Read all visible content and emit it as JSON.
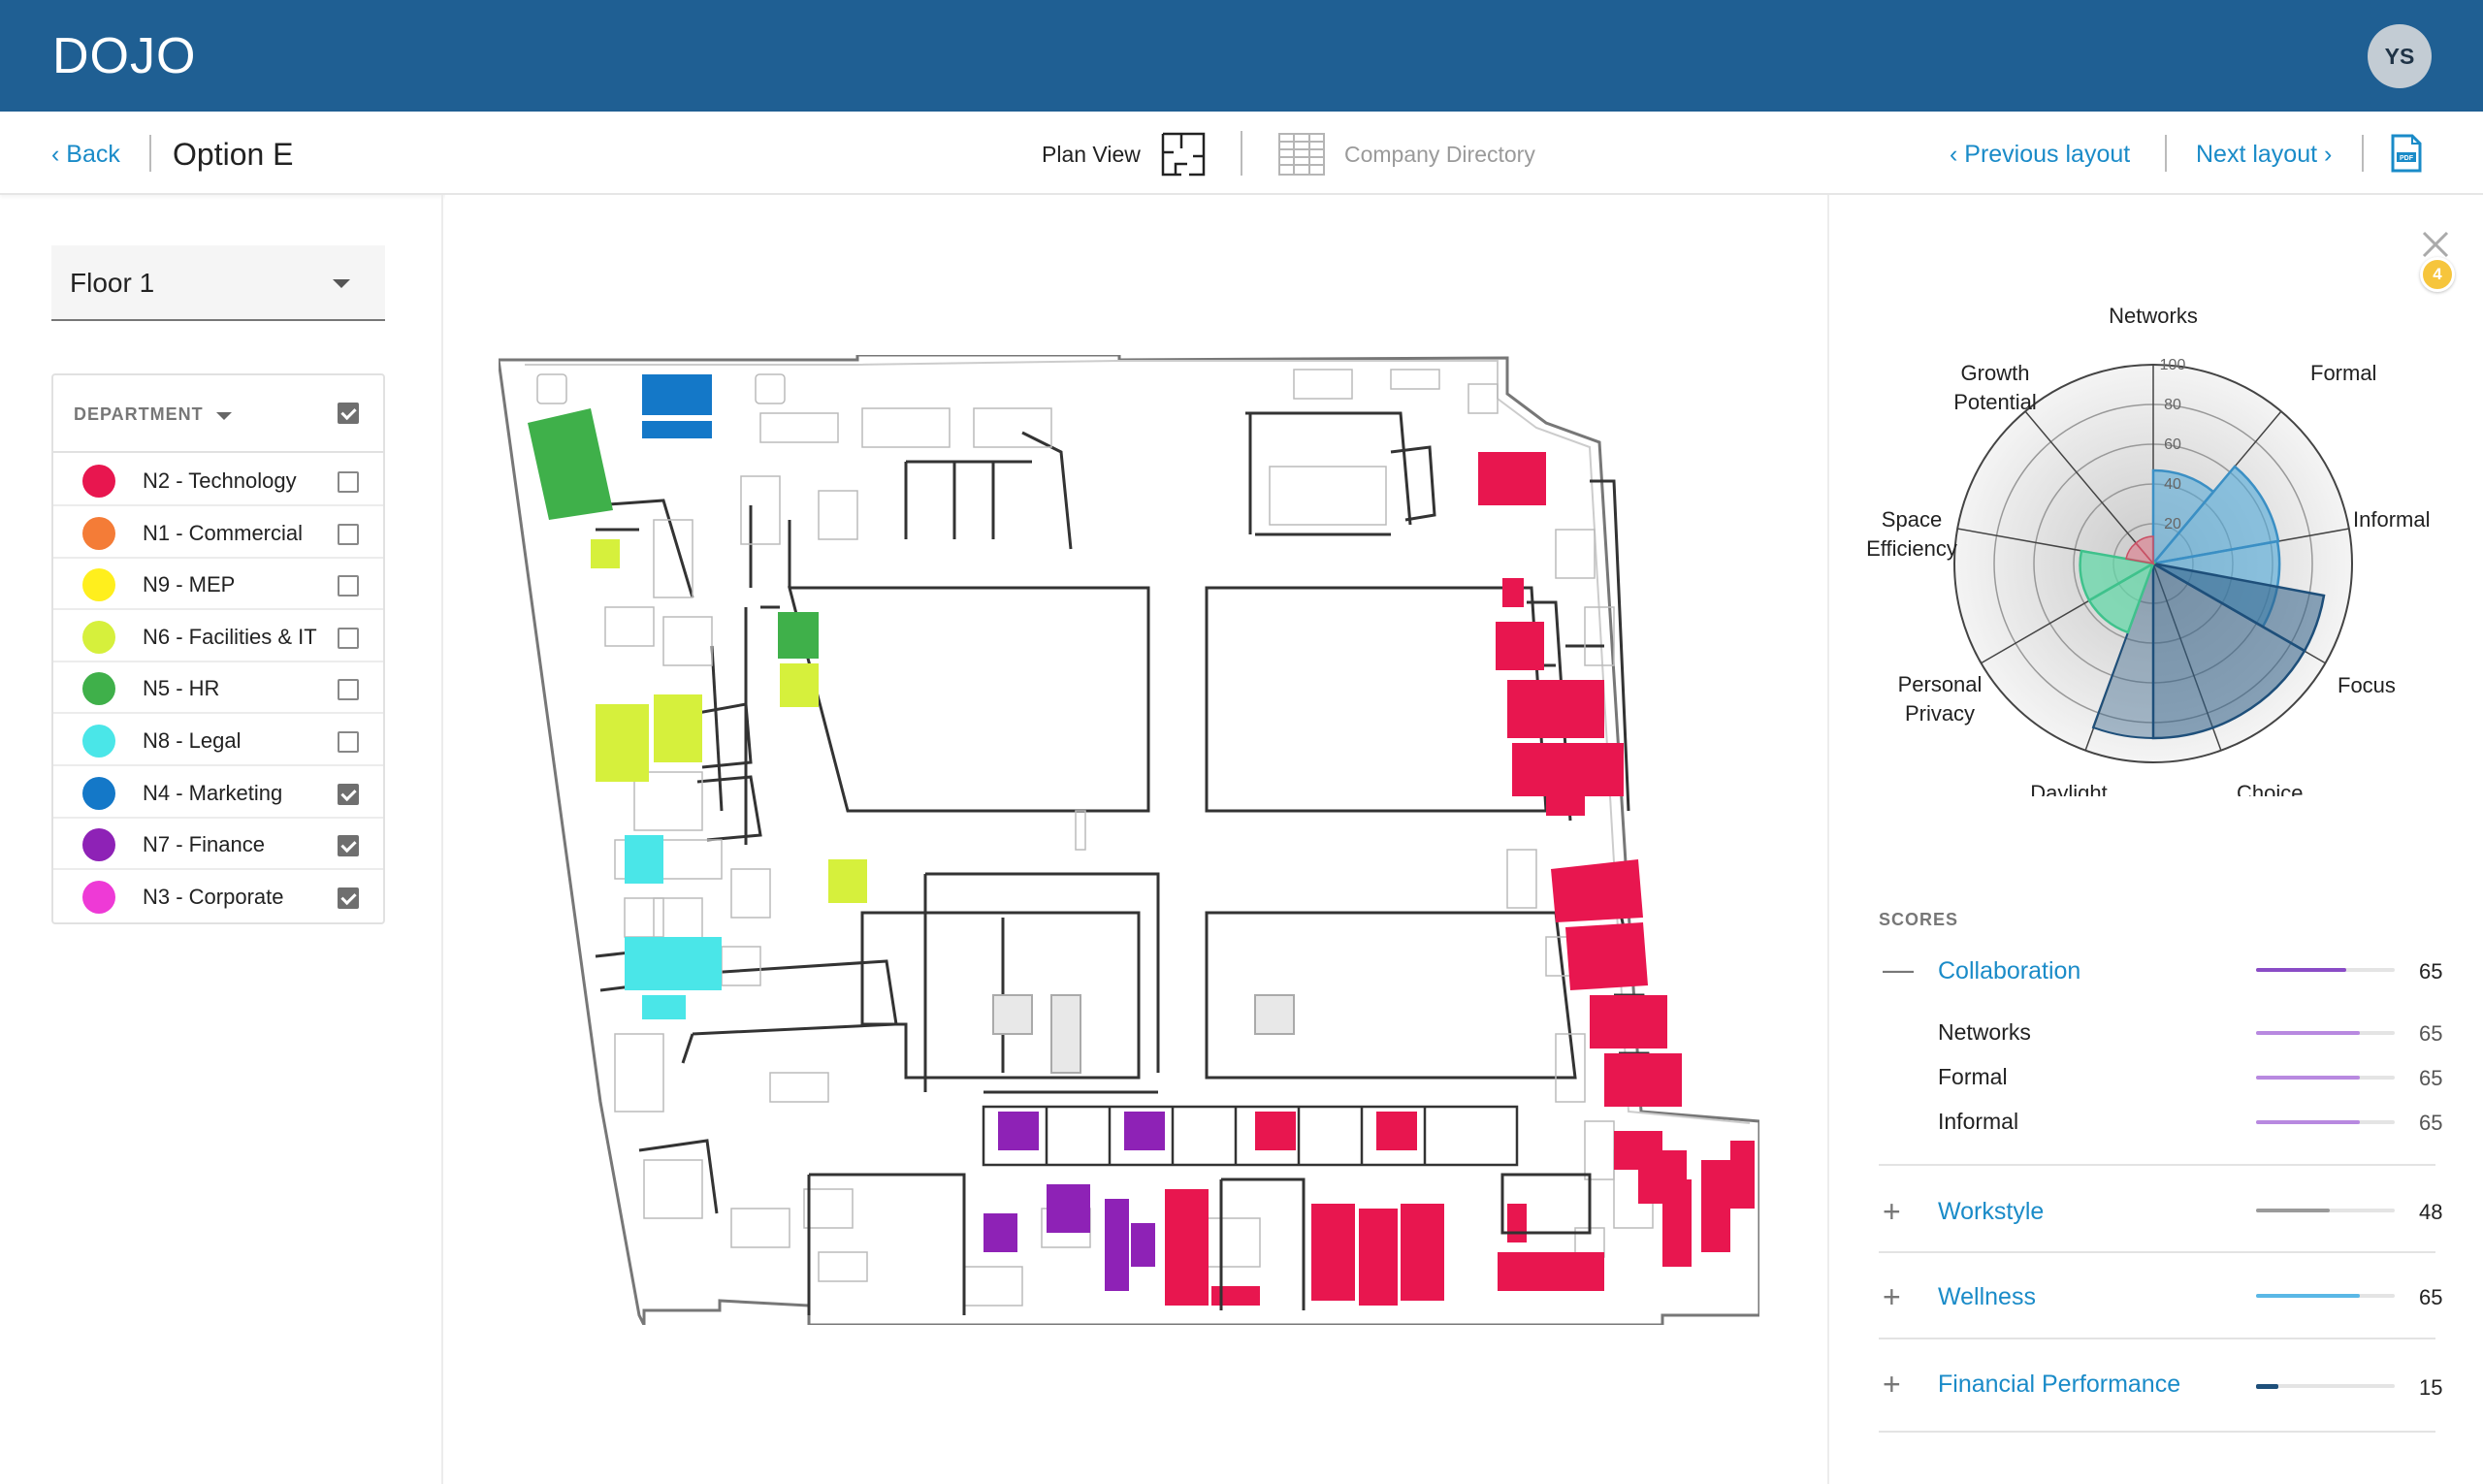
{
  "app": {
    "brand": "DOJO",
    "user_initials": "YS"
  },
  "subnav": {
    "back": "‹  Back",
    "title": "Option E",
    "plan_view": "Plan View",
    "company_directory": "Company Directory",
    "previous_layout": "‹ Previous layout",
    "next_layout": "Next layout ›"
  },
  "floor": {
    "selected": "Floor 1"
  },
  "department": {
    "header": "DEPARTMENT",
    "all_checked": true,
    "items": [
      {
        "label": "N2 - Technology",
        "color": "#e8164f",
        "checked": false
      },
      {
        "label": "N1 - Commercial",
        "color": "#f47c37",
        "checked": false
      },
      {
        "label": "N9 - MEP",
        "color": "#ffef1d",
        "checked": false
      },
      {
        "label": "N6 - Facilities & IT",
        "color": "#d6f03c",
        "checked": false
      },
      {
        "label": "N5 - HR",
        "color": "#3fb04a",
        "checked": false
      },
      {
        "label": "N8 - Legal",
        "color": "#4ae6e8",
        "checked": false
      },
      {
        "label": "N4 - Marketing",
        "color": "#1478c8",
        "checked": true
      },
      {
        "label": "N7 - Finance",
        "color": "#8e22b6",
        "checked": true
      },
      {
        "label": "N3 - Corporate",
        "color": "#ee3ad6",
        "checked": true
      }
    ]
  },
  "alerts": {
    "count": "4"
  },
  "radar": {
    "axes": [
      "Networks",
      "Formal",
      "Informal",
      "Focus",
      "Choice",
      "Daylight",
      "Personal Privacy",
      "Space Efficiency",
      "Growth Potential"
    ],
    "ticks": [
      "100",
      "80",
      "60",
      "40",
      "20"
    ],
    "labels": {
      "networks": "Networks",
      "formal": "Formal",
      "informal": "Informal",
      "focus": "Focus",
      "choice": "Choice",
      "daylight": "Daylight",
      "personal_privacy_1": "Personal",
      "personal_privacy_2": "Privacy",
      "space_efficiency_1": "Space",
      "space_efficiency_2": "Efficiency",
      "growth_potential_1": "Growth",
      "growth_potential_2": "Potential"
    }
  },
  "scores": {
    "header": "SCORES",
    "items": [
      {
        "name": "Collaboration",
        "value": "65",
        "toggle": "—"
      },
      {
        "name": "Networks",
        "value": "65"
      },
      {
        "name": "Formal",
        "value": "65"
      },
      {
        "name": "Informal",
        "value": "65"
      },
      {
        "name": "Workstyle",
        "value": "48",
        "toggle": "+"
      },
      {
        "name": "Wellness",
        "value": "65",
        "toggle": "+"
      },
      {
        "name": "Financial Performance",
        "value": "15",
        "toggle": "+"
      }
    ],
    "colors": {
      "collab": "#8a4cc6",
      "collab_sub": "#b889e0",
      "workstyle": "#9a9a9a",
      "wellness": "#5ab8e6",
      "financial": "#1e4f7a"
    }
  }
}
